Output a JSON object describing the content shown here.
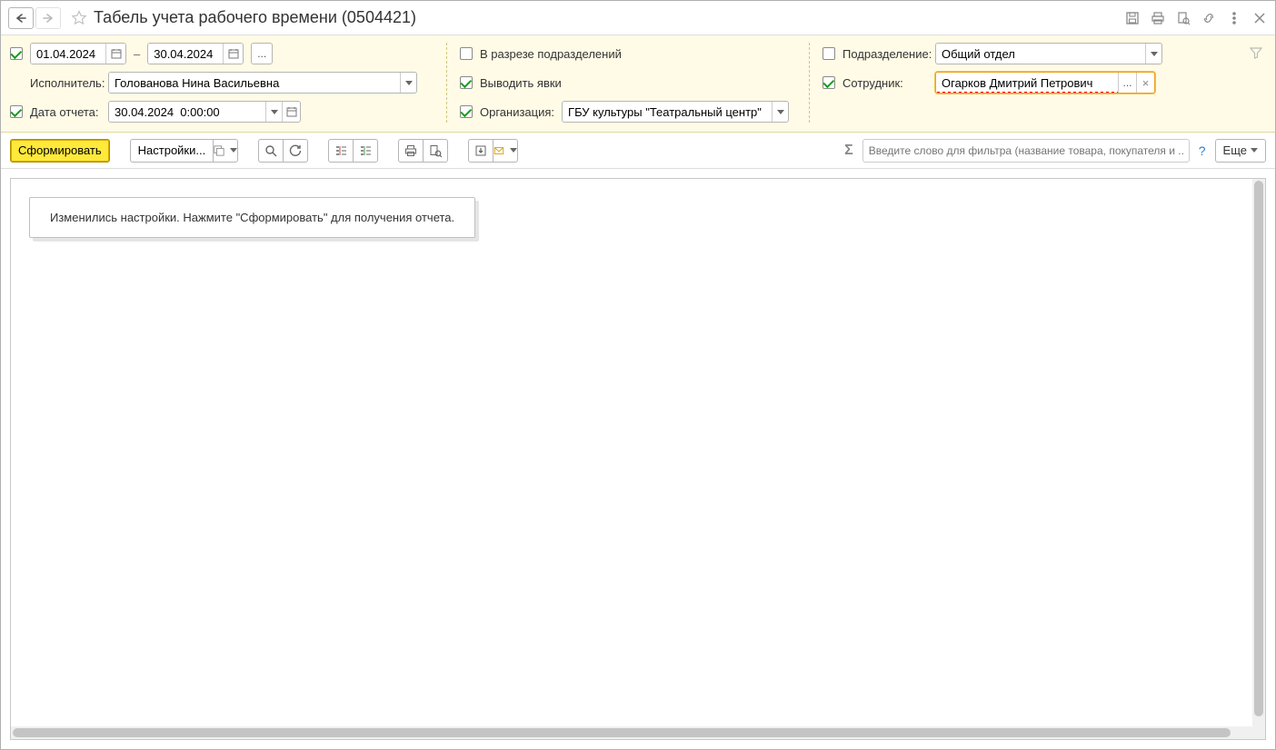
{
  "window": {
    "title": "Табель учета рабочего времени (0504421)"
  },
  "params": {
    "date_from": "01.04.2024",
    "date_to": "30.04.2024",
    "range_dash": "–",
    "period_ellipsis": "...",
    "executor_label": "Исполнитель:",
    "executor_value": "Голованова Нина Васильевна",
    "report_date_label": "Дата отчета:",
    "report_date_value": "30.04.2024  0:00:00",
    "by_department_label": "В разрезе подразделений",
    "show_attendance_label": "Выводить явки",
    "organization_label": "Организация:",
    "organization_value": "ГБУ культуры \"Театральный центр\"",
    "department_label": "Подразделение:",
    "department_value": "Общий отдел",
    "employee_label": "Сотрудник:",
    "employee_value": "Огарков Дмитрий Петрович",
    "select_btn": "...",
    "clear_btn": "×",
    "checks": {
      "period": true,
      "report_date": true,
      "by_department": false,
      "show_attendance": true,
      "organization": true,
      "department": false,
      "employee": true
    }
  },
  "toolbar": {
    "generate": "Сформировать",
    "settings": "Настройки...",
    "filter_placeholder": "Введите слово для фильтра (название товара, покупателя и ...",
    "help": "?",
    "more": "Еще"
  },
  "report": {
    "message": "Изменились настройки. Нажмите \"Сформировать\" для получения отчета."
  }
}
